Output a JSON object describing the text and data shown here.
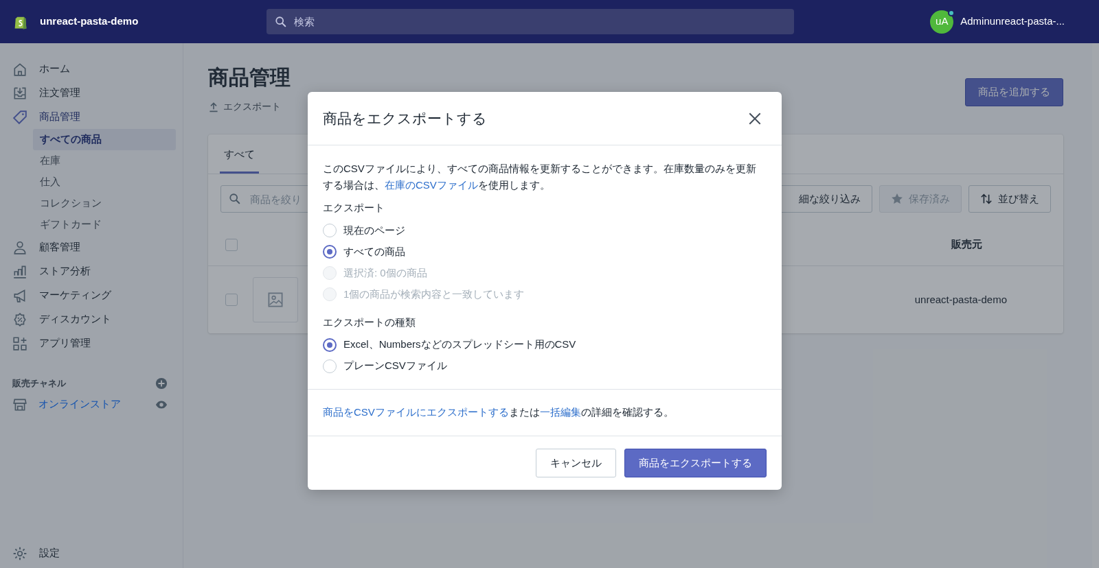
{
  "topbar": {
    "store_name": "unreact-pasta-demo",
    "search": {
      "placeholder": "検索"
    },
    "avatar_initials": "uA",
    "account_name": "Adminunreact-pasta-..."
  },
  "sidebar": {
    "items": [
      {
        "label": "ホーム",
        "selected": false
      },
      {
        "label": "注文管理",
        "selected": false
      },
      {
        "label": "商品管理",
        "selected": true,
        "children": [
          {
            "label": "すべての商品",
            "selected": true
          },
          {
            "label": "在庫",
            "selected": false
          },
          {
            "label": "仕入",
            "selected": false
          },
          {
            "label": "コレクション",
            "selected": false
          },
          {
            "label": "ギフトカード",
            "selected": false
          }
        ]
      },
      {
        "label": "顧客管理",
        "selected": false
      },
      {
        "label": "ストア分析",
        "selected": false
      },
      {
        "label": "マーケティング",
        "selected": false
      },
      {
        "label": "ディスカウント",
        "selected": false
      },
      {
        "label": "アプリ管理",
        "selected": false
      }
    ],
    "sales_channels": {
      "heading": "販売チャネル",
      "items": [
        {
          "label": "オンラインストア"
        }
      ]
    },
    "settings": {
      "label": "設定"
    }
  },
  "page": {
    "title": "商品管理",
    "export_link": "エクスポート",
    "add_button": "商品を追加する",
    "tabs": [
      {
        "label": "すべて",
        "selected": true
      }
    ],
    "filter": {
      "placeholder": "商品を絞り"
    },
    "toolbar_buttons": [
      {
        "label": "細な絞り込み",
        "disabled": false
      },
      {
        "label": "保存済み",
        "disabled": true
      },
      {
        "label": "並び替え",
        "disabled": false
      }
    ],
    "table": {
      "header_checked": false,
      "columns": [
        "販売元"
      ],
      "rows": [
        {
          "checked": false,
          "vendor": "unreact-pasta-demo"
        }
      ]
    }
  },
  "modal": {
    "title": "商品をエクスポートする",
    "description": {
      "before": "このCSVファイルにより、すべての商品情報を更新することができます。在庫数量のみを更新する場合は、",
      "link": "在庫のCSVファイル",
      "after": "を使用します。"
    },
    "export_group": {
      "label": "エクスポート",
      "options": [
        {
          "label": "現在のページ",
          "selected": false,
          "disabled": false
        },
        {
          "label": "すべての商品",
          "selected": true,
          "disabled": false
        },
        {
          "label": "選択済: 0個の商品",
          "selected": false,
          "disabled": true
        },
        {
          "label": "1個の商品が検索内容と一致しています",
          "selected": false,
          "disabled": true
        }
      ]
    },
    "type_group": {
      "label": "エクスポートの種類",
      "options": [
        {
          "label": "Excel、Numbersなどのスプレッドシート用のCSV",
          "selected": true,
          "disabled": false
        },
        {
          "label": "プレーンCSVファイル",
          "selected": false,
          "disabled": false
        }
      ]
    },
    "help": {
      "link_1": "商品をCSVファイルにエクスポートする",
      "middle": "または",
      "link_2": "一括編集",
      "after": "の詳細を確認する。"
    },
    "cancel_button": "キャンセル",
    "export_button": "商品をエクスポートする"
  }
}
